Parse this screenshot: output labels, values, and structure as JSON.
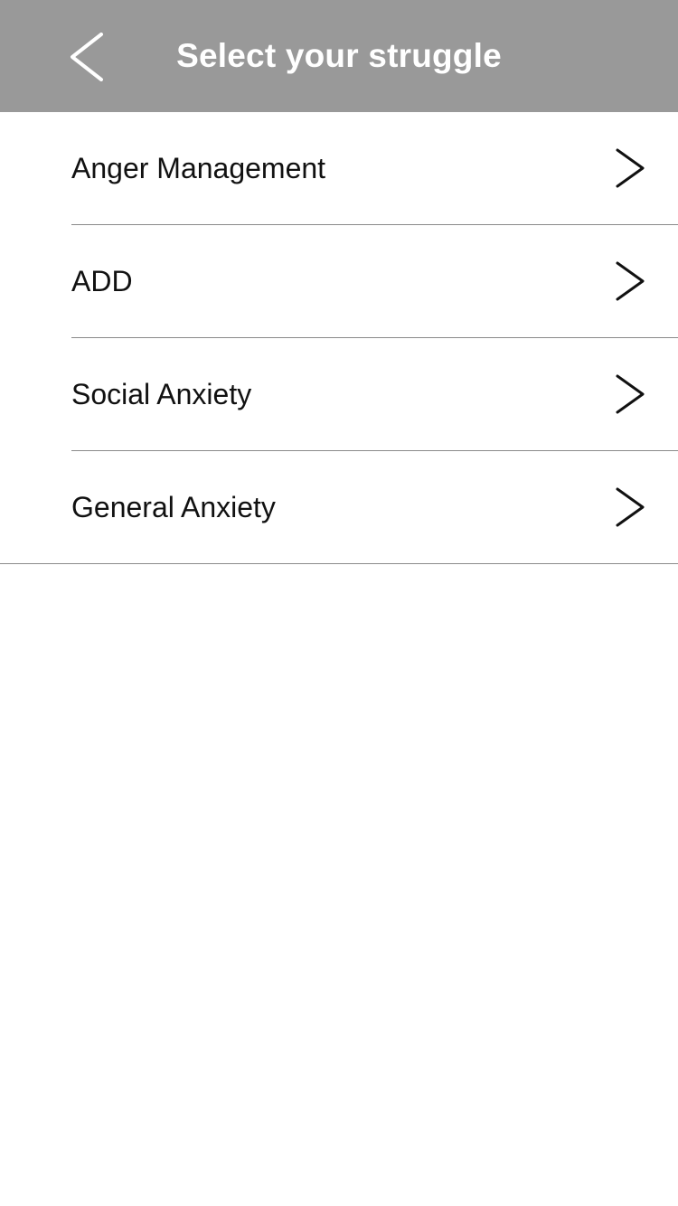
{
  "header": {
    "title": "Select your struggle",
    "back_icon": "chevron-left-icon",
    "background_color": "#999999",
    "text_color": "#ffffff"
  },
  "list": {
    "items": [
      {
        "label": "Anger Management",
        "icon": "chevron-right-icon"
      },
      {
        "label": "ADD",
        "icon": "chevron-right-icon"
      },
      {
        "label": "Social Anxiety",
        "icon": "chevron-right-icon"
      },
      {
        "label": "General Anxiety",
        "icon": "chevron-right-icon"
      }
    ],
    "divider_color": "#8a8a8a"
  }
}
